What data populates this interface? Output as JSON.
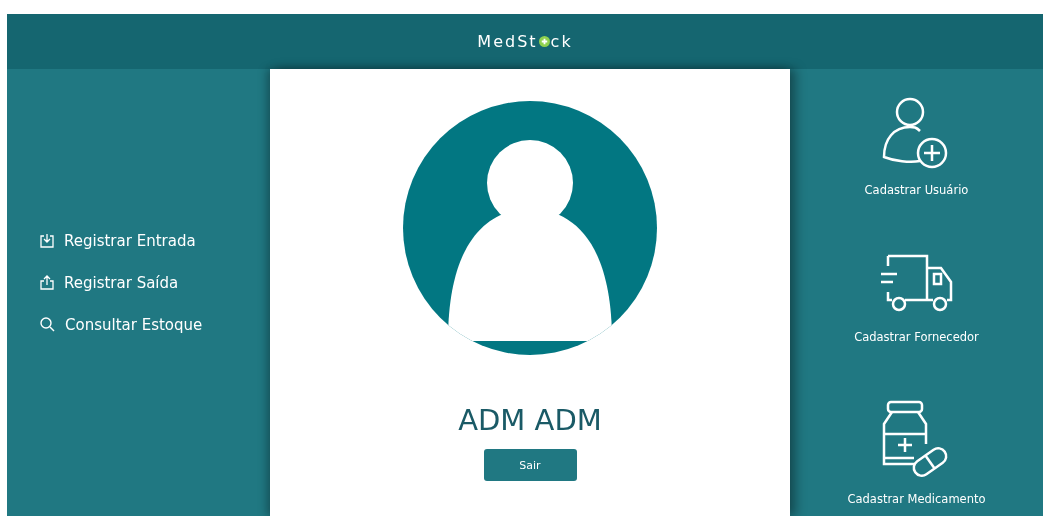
{
  "header": {
    "logo_before": "MedSt",
    "logo_after": "ck"
  },
  "menu": [
    {
      "kind": "download",
      "label": "Registrar Entrada"
    },
    {
      "kind": "upload",
      "label": "Registrar Saída"
    },
    {
      "kind": "search",
      "label": "Consultar Estoque"
    }
  ],
  "profile": {
    "name": "ADM ADM",
    "button": "Sair"
  },
  "actions": [
    {
      "kind": "user",
      "label": "Cadastrar Usuário"
    },
    {
      "kind": "truck",
      "label": "Cadastrar Fornecedor"
    },
    {
      "kind": "medicine",
      "label": "Cadastrar Medicamento"
    }
  ]
}
